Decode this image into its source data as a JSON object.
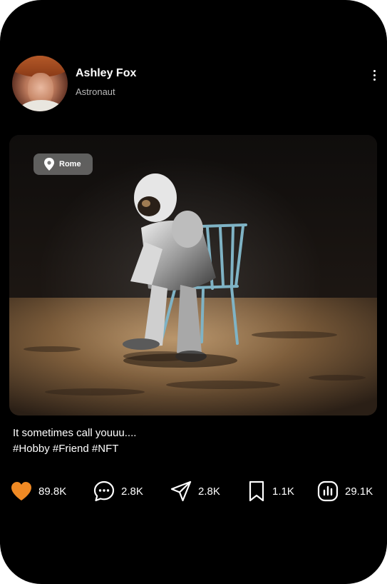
{
  "profile": {
    "name": "Ashley Fox",
    "role": "Astronaut"
  },
  "post": {
    "location": "Rome",
    "caption": "It sometimes call youuu....",
    "hashtags": "#Hobby #Friend #NFT"
  },
  "actions": {
    "likes": "89.8K",
    "comments": "2.8K",
    "shares": "2.8K",
    "saves": "1.1K",
    "views": "29.1K"
  },
  "icons": {
    "like": "heart-icon",
    "comment": "chat-bubble-icon",
    "share": "send-icon",
    "save": "bookmark-icon",
    "views": "stats-icon",
    "menu": "more-vertical-icon",
    "location": "map-pin-icon"
  },
  "colors": {
    "background": "#000000",
    "like_accent": "#f08a24",
    "text": "#ffffff",
    "subtext": "#b9b9b9"
  }
}
